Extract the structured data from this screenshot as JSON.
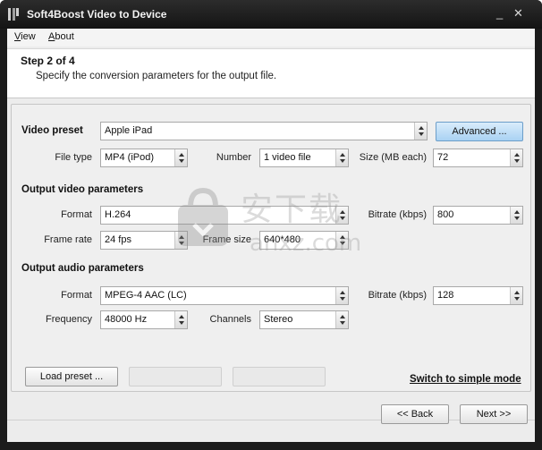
{
  "window": {
    "title": "Soft4Boost Video to Device",
    "minimize_glyph": "_",
    "close_glyph": "✕"
  },
  "menu": {
    "view": {
      "accel": "V",
      "rest": "iew"
    },
    "about": {
      "accel": "A",
      "rest": "bout"
    }
  },
  "header": {
    "step": "Step 2 of 4",
    "description": "Specify the conversion parameters for the output file."
  },
  "video_preset": {
    "label": "Video preset",
    "value": "Apple iPad",
    "advanced_button": "Advanced ..."
  },
  "file_type": {
    "label": "File type",
    "value": "MP4 (iPod)"
  },
  "number": {
    "label": "Number",
    "value": "1 video file"
  },
  "size": {
    "label": "Size (MB each)",
    "value": "72"
  },
  "output_video": {
    "section": "Output video parameters",
    "format_label": "Format",
    "format_value": "H.264",
    "bitrate_label": "Bitrate (kbps)",
    "bitrate_value": "800",
    "frame_rate_label": "Frame rate",
    "frame_rate_value": "24 fps",
    "frame_size_label": "Frame size",
    "frame_size_value": "640*480"
  },
  "output_audio": {
    "section": "Output audio parameters",
    "format_label": "Format",
    "format_value": "MPEG-4 AAC (LC)",
    "bitrate_label": "Bitrate (kbps)",
    "bitrate_value": "128",
    "frequency_label": "Frequency",
    "frequency_value": "48000 Hz",
    "channels_label": "Channels",
    "channels_value": "Stereo"
  },
  "bottom": {
    "load_preset": "Load preset ...",
    "switch_mode": "Switch to simple mode"
  },
  "nav": {
    "back": "<< Back",
    "next": "Next >>"
  },
  "watermark": {
    "cn": "安下载",
    "en": "anxz.com"
  },
  "colors": {
    "titlebar": "#1b1b1b",
    "advanced_button": "#a9d2f3",
    "panel": "#efefef"
  }
}
